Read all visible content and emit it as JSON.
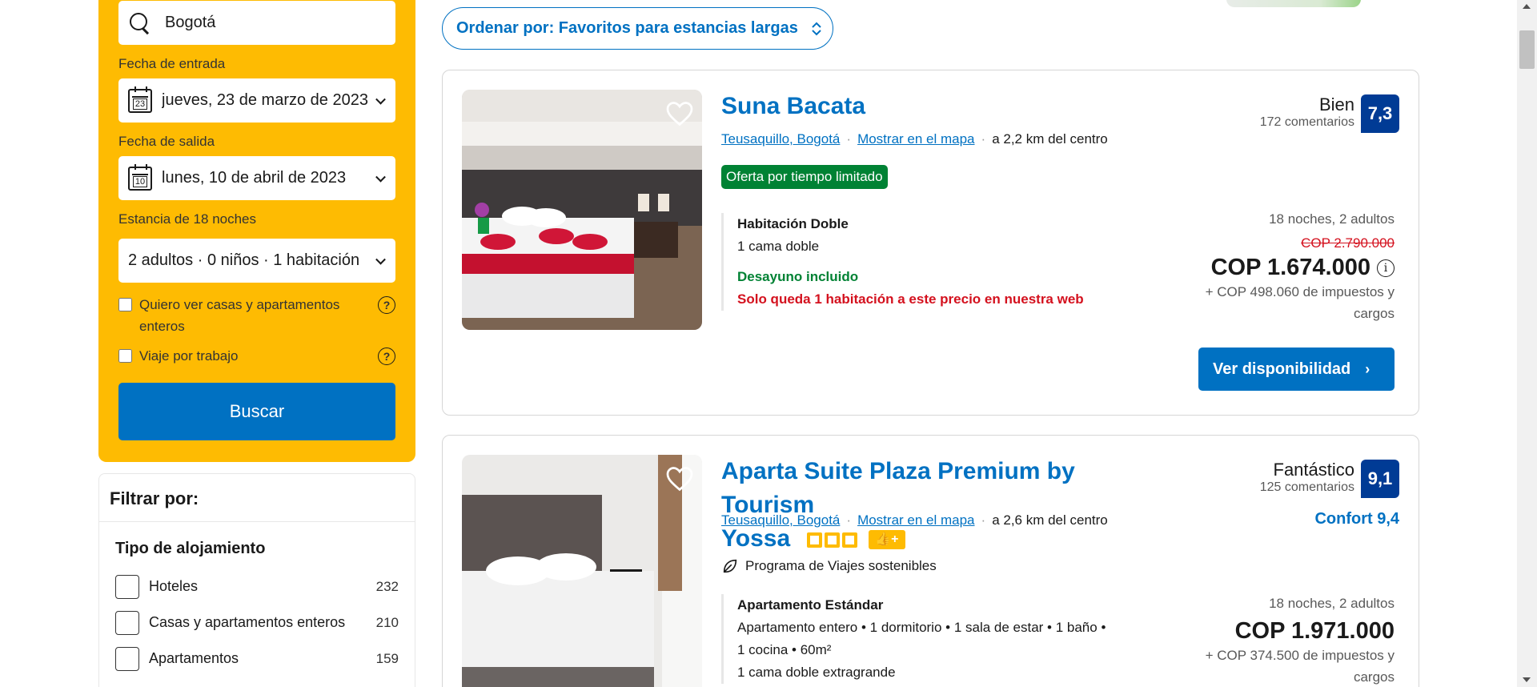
{
  "search": {
    "destination": "Bogotá",
    "checkin_label": "Fecha de entrada",
    "checkin_value": "jueves, 23 de marzo de 2023",
    "checkin_day": "23",
    "checkout_label": "Fecha de salida",
    "checkout_value": "lunes, 10 de abril de 2023",
    "checkout_day": "10",
    "stay_label": "Estancia de 18 noches",
    "guests_value": "2 adultos · 0 niños · 1 habitación",
    "check_homes": "Quiero ver casas y apartamentos enteros",
    "check_work": "Viaje por trabajo",
    "help": "?",
    "button": "Buscar"
  },
  "filters": {
    "title": "Filtrar por:",
    "group_title": "Tipo de alojamiento",
    "items": [
      {
        "label": "Hoteles",
        "count": "232"
      },
      {
        "label": "Casas y apartamentos enteros",
        "count": "210"
      },
      {
        "label": "Apartamentos",
        "count": "159"
      }
    ]
  },
  "sort": {
    "label": "Ordenar por: Favoritos para estancias largas"
  },
  "properties": [
    {
      "name": "Suna Bacata",
      "location": "Teusaquillo, Bogotá",
      "map_link": "Mostrar en el mapa",
      "distance": "a 2,2 km del centro",
      "deal_badge": "Oferta por tiempo limitado",
      "score_word": "Bien",
      "reviews": "172 comentarios",
      "score": "7,3",
      "room_title": "Habitación Doble",
      "room_detail": "1 cama doble",
      "breakfast": "Desayuno incluido",
      "scarcity": "Solo queda 1 habitación a este precio en nuestra web",
      "nights": "18 noches, 2 adultos",
      "old_price": "COP 2.790.000",
      "price": "COP 1.674.000",
      "taxes": "+ COP 498.060 de impuestos y cargos",
      "cta": "Ver disponibilidad"
    },
    {
      "name_line1": "Aparta Suite Plaza Premium by Tourism",
      "name_line2": "Yossa",
      "location": "Teusaquillo, Bogotá",
      "map_link": "Mostrar en el mapa",
      "distance": "a 2,6 km del centro",
      "sustainable": "Programa de Viajes sostenibles",
      "score_word": "Fantástico",
      "reviews": "125 comentarios",
      "score": "9,1",
      "comfort": "Confort 9,4",
      "room_title": "Apartamento Estándar",
      "room_detail1": "Apartamento entero • 1 dormitorio • 1 sala de estar • 1 baño •",
      "room_detail2": "1 cocina • 60m²",
      "room_detail3": "1 cama doble extragrande",
      "nights": "18 noches, 2 adultos",
      "price": "COP 1.971.000",
      "taxes": "+ COP 374.500 de impuestos y cargos"
    }
  ],
  "colors": {
    "brand_blue": "#0071c2",
    "search_yellow": "#febb02",
    "score_blue": "#003b95",
    "deal_green": "#008234",
    "scarcity_red": "#d4111e"
  }
}
